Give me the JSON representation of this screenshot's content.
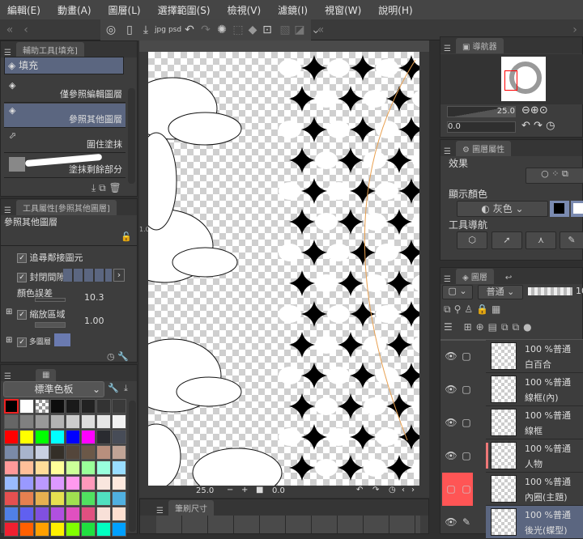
{
  "menu": [
    "編輯(E)",
    "動畫(A)",
    "圖層(L)",
    "選擇範圍(S)",
    "檢視(V)",
    "濾鏡(I)",
    "視窗(W)",
    "說明(H)"
  ],
  "sub_tool": {
    "tab": "輔助工具[填充]",
    "group": "填充",
    "items": [
      "僅參照編輯圖層",
      "參照其他圖層",
      "圍住塗抹",
      "塗抹剩餘部分"
    ],
    "selected": 1
  },
  "tool_property": {
    "tab": "工具屬性[參照其他圖層]",
    "title": "參照其他圖層",
    "follow_adjacent": "追尋鄰接圖元",
    "close_gap": "封閉間隙",
    "color_margin_label": "顏色誤差",
    "color_margin": "10.3",
    "area_scaling_label": "縮放區域",
    "area_scaling": "1.00",
    "multi_ref": "多圖層"
  },
  "palette": {
    "set": "標準色板",
    "colors": [
      "#000000",
      "#ffffff",
      "checker",
      "#0d0d0d",
      "#1a1a1a",
      "#222222",
      "#333333",
      "#3a3a3a",
      "#666666",
      "#808080",
      "#999999",
      "#b3b3b3",
      "#cccccc",
      "#dddddd",
      "#e6e6e6",
      "#f2f2f2",
      "#ff0000",
      "#ffff00",
      "#00ff00",
      "#00ffff",
      "#0000ff",
      "#ff00ff",
      "#2a2b30",
      "#474c57",
      "#7a8aa8",
      "#a8b4cc",
      "#c8d0e2",
      "#342f28",
      "#54463b",
      "#6b5848",
      "#b88f7d",
      "#c0a496",
      "#ff9999",
      "#ffbf99",
      "#ffdd99",
      "#ffff99",
      "#ccff99",
      "#99ff99",
      "#99ffdd",
      "#99ddff",
      "#99bbff",
      "#9999ff",
      "#bb99ff",
      "#dd99ff",
      "#ff99ee",
      "#ff99bb",
      "#f9e6de",
      "#fde9de",
      "#e55050",
      "#e68050",
      "#e6b050",
      "#e6e050",
      "#a0e050",
      "#50e060",
      "#50e0c0",
      "#50b0e0",
      "#5080e6",
      "#6060f0",
      "#8050e0",
      "#b050e0",
      "#e050c0",
      "#e05080",
      "#f8e0d8",
      "#fde0d0",
      "#f02030",
      "#ff6000",
      "#ffa000",
      "#fff000",
      "#80ff00",
      "#20e040",
      "#00ffc0",
      "#00a0ff"
    ]
  },
  "canvas": {
    "zoom": "25.0",
    "rotation": "0.0",
    "ruler": "1.0"
  },
  "brush_size": {
    "tab": "筆刷尺寸"
  },
  "navigator": {
    "tab": "導航器",
    "zoom": "25.0",
    "rotation": "0.0"
  },
  "layer_property": {
    "tab": "圖層屬性",
    "effect": "效果",
    "display_color": "顯示顏色",
    "color_mode": "灰色",
    "tool_nav": "工具導航"
  },
  "layers": {
    "tab": "圖層",
    "blend": "普通",
    "opacity_short": "10",
    "items": [
      {
        "opacity": "100 %普通",
        "name": "白百合"
      },
      {
        "opacity": "100 %普通",
        "name": "線框(內)"
      },
      {
        "opacity": "100 %普通",
        "name": "線框"
      },
      {
        "opacity": "100 %普通",
        "name": "人物"
      },
      {
        "opacity": "100 %普通",
        "name": "內圈(主題)"
      },
      {
        "opacity": "100 %普通",
        "name": "後光(蝶型)"
      }
    ]
  }
}
